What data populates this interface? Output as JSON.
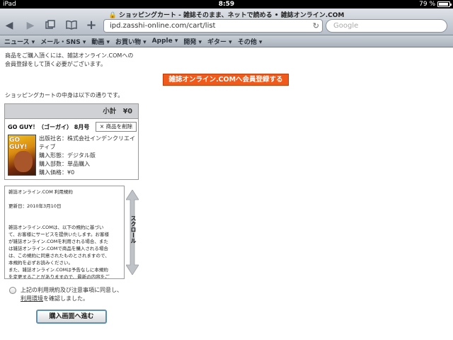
{
  "status": {
    "device": "iPad",
    "time": "8:59",
    "battery": "79 %"
  },
  "browser": {
    "page_title": "ショッピングカート - 雑誌そのまま、ネットで読める • 雑誌オンライン.COM",
    "url": "ipd.zasshi-online.com/cart/list",
    "search_placeholder": "Google",
    "icons": {
      "back": "back-arrow-icon",
      "forward": "forward-arrow-icon",
      "pages": "pages-icon",
      "bookmarks": "book-icon",
      "add": "plus-icon",
      "reload": "reload-icon",
      "lock": "lock-icon"
    },
    "bookmarks": [
      "ニュース ▾",
      "メール・SNS ▾",
      "動画 ▾",
      "お買い物 ▾",
      "Apple ▾",
      "開発 ▾",
      "ギター ▾",
      "その他 ▾"
    ]
  },
  "page": {
    "intro_line1": "商品をご購入頂くには、雑誌オンライン.COMへの",
    "intro_line2": "会員登録をして頂く必要がございます。",
    "register_button": "雑誌オンライン.COMへ会員登録する",
    "cart_caption": "ショッピングカートの中身は以下の通りです。",
    "subtotal": "小計　¥0",
    "item": {
      "title": "GO GUY！（ゴーガイ） 8月号",
      "remove_button": "× 商品を削除",
      "cover_text": "GO GUY!",
      "publisher_line1": "出版社名：株式会社インデンクリエイ",
      "publisher_line2": "ティブ",
      "format": "購入形態：デジタル版",
      "quantity": "購入部数：単品購入",
      "price": "購入価格：¥0"
    },
    "terms": {
      "heading": "雑誌オンライン.COM 利用規約",
      "updated": "更新日：2010年3月10日",
      "body": [
        "雑誌オンライン.COMは、以下の規約に基づい",
        "て、お客様にサービスを提供いたします。お客様",
        "が雑誌オンライン.COMを利用される場合、また",
        "は雑誌オンライン.COMで商品を購入される場合",
        "は、この規約に同意されたものとされますので、",
        "本規約を必ずお読みください。",
        "また、雑誌オンライン.COMは予告なしに本規約",
        "を変更することがありますので、最新の内容をご"
      ]
    },
    "scroll_label": "スクロール",
    "agree_line1": "上記の利用規約及び注意事項に同意し、",
    "agree_link": "利用環境",
    "agree_line2_suffix": "を確認しました。",
    "proceed_button": "購入画面へ進む"
  }
}
